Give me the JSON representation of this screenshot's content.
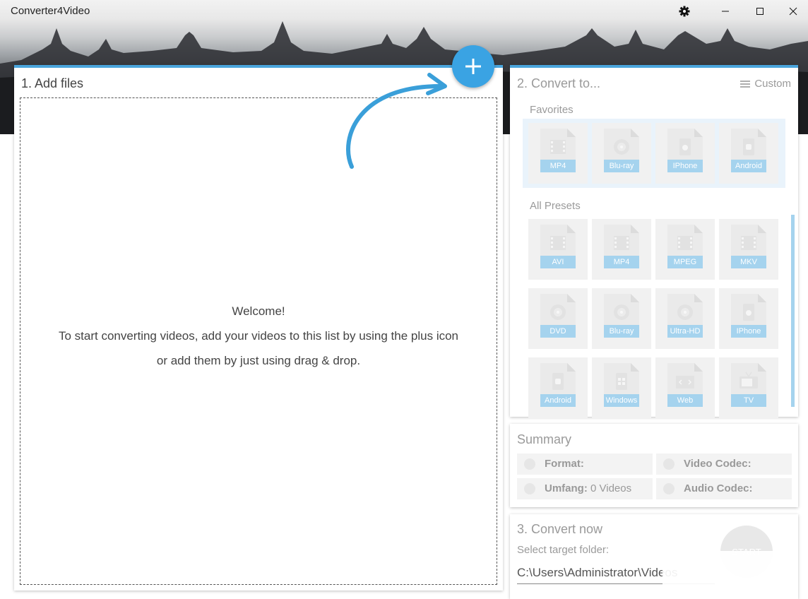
{
  "app": {
    "title": "Converter4Video"
  },
  "add_files": {
    "title": "1. Add files",
    "welcome": "Welcome!",
    "line1": "To start converting videos, add your videos to this list by using the plus icon",
    "line2": "or add them by just using drag & drop."
  },
  "convert_to": {
    "title": "2. Convert to...",
    "custom_label": "Custom",
    "favorites_label": "Favorites",
    "favorites": [
      {
        "label": "MP4",
        "icon": "film-icon"
      },
      {
        "label": "Blu-ray",
        "icon": "disc-icon"
      },
      {
        "label": "IPhone",
        "icon": "apple-icon"
      },
      {
        "label": "Android",
        "icon": "android-icon"
      }
    ],
    "presets_label": "All Presets",
    "presets": [
      {
        "label": "AVI",
        "icon": "film-icon"
      },
      {
        "label": "MP4",
        "icon": "film-icon"
      },
      {
        "label": "MPEG",
        "icon": "film-icon"
      },
      {
        "label": "MKV",
        "icon": "film-icon"
      },
      {
        "label": "DVD",
        "icon": "disc-icon"
      },
      {
        "label": "Blu-ray",
        "icon": "disc-icon"
      },
      {
        "label": "Ultra-HD",
        "icon": "disc-icon"
      },
      {
        "label": "IPhone",
        "icon": "apple-icon"
      },
      {
        "label": "Android",
        "icon": "android-icon"
      },
      {
        "label": "Windows",
        "icon": "windows-icon"
      },
      {
        "label": "Web",
        "icon": "code-icon"
      },
      {
        "label": "TV",
        "icon": "tv-icon"
      }
    ]
  },
  "summary": {
    "title": "Summary",
    "format_label": "Format:",
    "video_codec_label": "Video Codec:",
    "umfang_label": "Umfang:",
    "umfang_value": "0 Videos",
    "audio_codec_label": "Audio Codec:"
  },
  "convert_now": {
    "title": "3. Convert now",
    "target_label": "Select target folder:",
    "target_value": "C:\\Users\\Administrator\\Videos",
    "start_label": "START"
  },
  "colors": {
    "accent": "#3aa3e3",
    "tile_label": "#a5d3ee",
    "favorites_bg": "#e9f3fb"
  }
}
